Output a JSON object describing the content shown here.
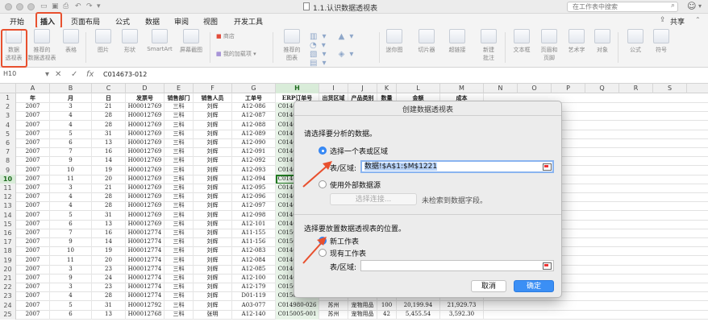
{
  "window": {
    "doc_title": "1.1.认识数据透视表",
    "search_placeholder": "在工作表中搜索"
  },
  "tabs": [
    {
      "label": "开始"
    },
    {
      "label": "插入"
    },
    {
      "label": "页面布局"
    },
    {
      "label": "公式"
    },
    {
      "label": "数据"
    },
    {
      "label": "审阅"
    },
    {
      "label": "视图"
    },
    {
      "label": "开发工具"
    }
  ],
  "share_label": "共享",
  "ribbon": {
    "pivot": "数据\n透视表",
    "rec_pivot": "推荐的\n数据透视表",
    "table": "表格",
    "picture": "图片",
    "shapes": "形状",
    "smartart": "SmartArt",
    "screenshot": "屏幕截图",
    "store": "商店",
    "addins": "我的加载项",
    "rec_charts": "推荐的\n图表",
    "sparklines": "迷你图",
    "slicer": "切片器",
    "hyperlink": "超链接",
    "new_comment": "新建\n批注",
    "textbox": "文本框",
    "header_footer": "页眉和\n页脚",
    "wordart": "艺术字",
    "object": "对象",
    "equation": "公式",
    "symbol": "符号"
  },
  "formula_bar": {
    "cell_ref": "H10",
    "value": "C014673-012"
  },
  "columns": [
    "A",
    "B",
    "C",
    "D",
    "E",
    "F",
    "G",
    "H",
    "I",
    "J",
    "K",
    "L",
    "M",
    "N",
    "O",
    "P",
    "Q",
    "R",
    "S"
  ],
  "selected_column": "H",
  "selected_row": "10",
  "rows": [
    {
      "n": "1",
      "cells": [
        "年",
        "月",
        "日",
        "发票号",
        "销售部门",
        "销售人员",
        "工单号",
        "ERP订单号",
        "出货区域",
        "产品类别",
        "数量",
        "金额",
        "成本"
      ]
    },
    {
      "n": "2",
      "cells": [
        "2007",
        "3",
        "21",
        "H00012769",
        "三科",
        "刘辉",
        "A12-086",
        "C014673-001",
        "",
        "",
        "",
        "",
        ""
      ]
    },
    {
      "n": "3",
      "cells": [
        "2007",
        "4",
        "28",
        "H00012769",
        "三科",
        "刘辉",
        "A12-087",
        "C014673-002",
        "",
        "",
        "",
        "",
        ""
      ]
    },
    {
      "n": "4",
      "cells": [
        "2007",
        "4",
        "28",
        "H00012769",
        "三科",
        "刘辉",
        "A12-088",
        "C014673-003",
        "",
        "",
        "",
        "",
        ""
      ]
    },
    {
      "n": "5",
      "cells": [
        "2007",
        "5",
        "31",
        "H00012769",
        "三科",
        "刘辉",
        "A12-089",
        "C014673-004",
        "",
        "",
        "",
        "",
        ""
      ]
    },
    {
      "n": "6",
      "cells": [
        "2007",
        "6",
        "13",
        "H00012769",
        "三科",
        "刘辉",
        "A12-090",
        "C014673-005",
        "",
        "",
        "",
        "",
        ""
      ]
    },
    {
      "n": "7",
      "cells": [
        "2007",
        "7",
        "16",
        "H00012769",
        "三科",
        "刘辉",
        "A12-091",
        "C014673-006",
        "",
        "",
        "",
        "",
        ""
      ]
    },
    {
      "n": "8",
      "cells": [
        "2007",
        "9",
        "14",
        "H00012769",
        "三科",
        "刘辉",
        "A12-092",
        "C014673-007",
        "",
        "",
        "",
        "",
        ""
      ]
    },
    {
      "n": "9",
      "cells": [
        "2007",
        "10",
        "19",
        "H00012769",
        "三科",
        "刘辉",
        "A12-093",
        "C014673-008",
        "",
        "",
        "",
        "",
        ""
      ]
    },
    {
      "n": "10",
      "cells": [
        "2007",
        "11",
        "20",
        "H00012769",
        "三科",
        "刘辉",
        "A12-094",
        "C014673-012",
        "",
        "",
        "",
        "",
        ""
      ]
    },
    {
      "n": "11",
      "cells": [
        "2007",
        "3",
        "21",
        "H00012769",
        "三科",
        "刘辉",
        "A12-095",
        "C014673-010",
        "",
        "",
        "",
        "",
        ""
      ]
    },
    {
      "n": "12",
      "cells": [
        "2007",
        "4",
        "28",
        "H00012769",
        "三科",
        "刘辉",
        "A12-096",
        "C014673-011",
        "",
        "",
        "",
        "",
        ""
      ]
    },
    {
      "n": "13",
      "cells": [
        "2007",
        "4",
        "28",
        "H00012769",
        "三科",
        "刘辉",
        "A12-097",
        "C014673-012",
        "",
        "",
        "",
        "",
        ""
      ]
    },
    {
      "n": "14",
      "cells": [
        "2007",
        "5",
        "31",
        "H00012769",
        "三科",
        "刘辉",
        "A12-098",
        "C014673-013",
        "",
        "",
        "",
        "",
        ""
      ]
    },
    {
      "n": "15",
      "cells": [
        "2007",
        "6",
        "13",
        "H00012769",
        "三科",
        "刘辉",
        "A12-101",
        "C014673-014",
        "",
        "",
        "",
        "",
        ""
      ]
    },
    {
      "n": "16",
      "cells": [
        "2007",
        "7",
        "16",
        "H00012774",
        "三科",
        "刘辉",
        "A11-155",
        "C015005-001",
        "",
        "",
        "",
        "",
        ""
      ]
    },
    {
      "n": "17",
      "cells": [
        "2007",
        "9",
        "14",
        "H00012774",
        "三科",
        "刘辉",
        "A11-156",
        "C015005-002",
        "",
        "",
        "",
        "",
        ""
      ]
    },
    {
      "n": "18",
      "cells": [
        "2007",
        "10",
        "19",
        "H00012774",
        "三科",
        "刘辉",
        "A12-083",
        "C014673-015",
        "",
        "",
        "",
        "",
        ""
      ]
    },
    {
      "n": "19",
      "cells": [
        "2007",
        "11",
        "20",
        "H00012774",
        "三科",
        "刘辉",
        "A12-084",
        "C014673-016",
        "",
        "",
        "",
        "",
        ""
      ]
    },
    {
      "n": "20",
      "cells": [
        "2007",
        "3",
        "23",
        "H00012774",
        "三科",
        "刘辉",
        "A12-085",
        "C014673-017",
        "",
        "",
        "",
        "",
        ""
      ]
    },
    {
      "n": "21",
      "cells": [
        "2007",
        "9",
        "24",
        "H00012774",
        "三科",
        "刘辉",
        "A12-100",
        "C014673-018",
        "",
        "",
        "",
        "",
        ""
      ]
    },
    {
      "n": "22",
      "cells": [
        "2007",
        "3",
        "23",
        "H00012774",
        "三科",
        "刘辉",
        "A12-179",
        "C015005-003",
        "",
        "",
        "",
        "",
        ""
      ]
    },
    {
      "n": "23",
      "cells": [
        "2007",
        "4",
        "28",
        "H00012774",
        "三科",
        "刘辉",
        "D01-119",
        "C015005-004",
        "",
        "",
        "",
        "",
        ""
      ]
    },
    {
      "n": "24",
      "cells": [
        "2007",
        "5",
        "31",
        "H00012792",
        "三科",
        "刘辉",
        "A03-077",
        "C014980-026",
        "苏州",
        "宠物用品",
        "100",
        "20,199.94",
        "21,929.73"
      ]
    },
    {
      "n": "25",
      "cells": [
        "2007",
        "6",
        "13",
        "H00012768",
        "三科",
        "张明",
        "A12-140",
        "C015005-001",
        "苏州",
        "宠物用品",
        "42",
        "5,455.54",
        "3,592.30"
      ]
    }
  ],
  "dialog": {
    "title": "创建数据透视表",
    "section1": "请选择要分析的数据。",
    "opt_range": "选择一个表或区域",
    "range_label": "表/区域:",
    "range_value": "数据!$A$1:$M$1221",
    "opt_external": "使用外部数据源",
    "choose_conn": "选择连接...",
    "no_fields": "未检索到数据字段。",
    "section2": "选择要放置数据透视表的位置。",
    "opt_new_sheet": "新工作表",
    "opt_existing": "现有工作表",
    "range_label2": "表/区域:",
    "cancel": "取消",
    "ok": "确定"
  },
  "colors": {
    "highlight": "#e8502e",
    "primary_button": "#3b8ff5",
    "selection_green": "#1e6b1e"
  }
}
